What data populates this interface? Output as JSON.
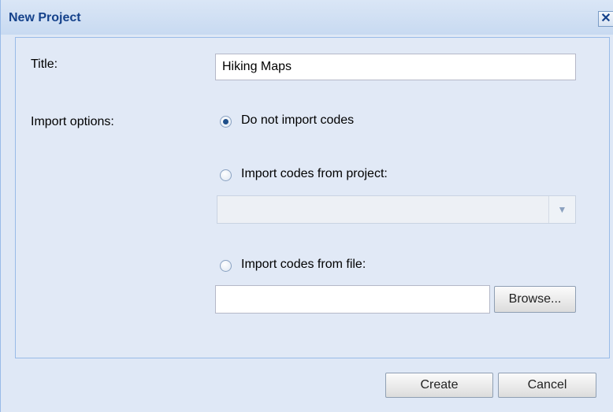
{
  "dialog": {
    "title": "New Project",
    "close_symbol": "✕"
  },
  "form": {
    "title_label": "Title:",
    "title_value": "Hiking Maps",
    "import_label": "Import options:",
    "options": [
      {
        "label": "Do not import codes",
        "checked": true
      },
      {
        "label": "Import codes from project:",
        "checked": false
      },
      {
        "label": "Import codes from file:",
        "checked": false
      }
    ],
    "project_combo_value": "",
    "file_value": "",
    "browse_label": "Browse..."
  },
  "footer": {
    "create_label": "Create",
    "cancel_label": "Cancel"
  },
  "icons": {
    "combo_trigger": "chevron-down-icon",
    "close": "close-icon"
  },
  "colors": {
    "title_text": "#15428b",
    "dialog_bg": "#dfe8f6",
    "border": "#99bbe8"
  }
}
